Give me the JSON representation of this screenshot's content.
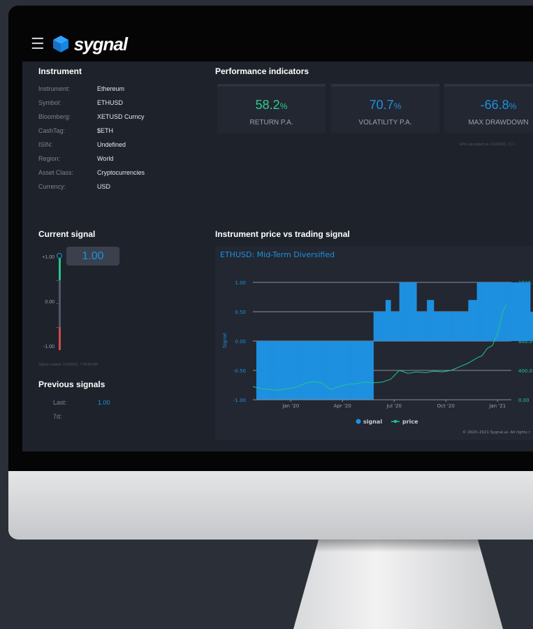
{
  "app": {
    "name": "sygnal"
  },
  "instrument": {
    "title": "Instrument",
    "fields": [
      {
        "label": "Instrument:",
        "value": "Ethereum"
      },
      {
        "label": "Symbol:",
        "value": "ETHUSD"
      },
      {
        "label": "Bloomberg:",
        "value": "XETUSD Curncy"
      },
      {
        "label": "CashTag:",
        "value": "$ETH"
      },
      {
        "label": "ISIN:",
        "value": "Undefined"
      },
      {
        "label": "Region:",
        "value": "World"
      },
      {
        "label": "Asset Class:",
        "value": "Cryptocurrencies"
      },
      {
        "label": "Currency:",
        "value": "USD"
      }
    ]
  },
  "performance": {
    "title": "Performance indicators",
    "kpis": [
      {
        "value": "58.2",
        "unit": "%",
        "label": "RETURN P.A.",
        "color": "#2ecc8f"
      },
      {
        "value": "70.7",
        "unit": "%",
        "label": "VOLATILITY P.A.",
        "color": "#1e90e0"
      },
      {
        "value": "-66.8",
        "unit": "%",
        "label": "MAX DRAWDOWN",
        "color": "#1e90e0"
      }
    ],
    "note": "KPIs calculated on: 1/12/2021, 11:1"
  },
  "current_signal": {
    "title": "Current signal",
    "value": "1.00",
    "gauge_labels": [
      "+1.00",
      "0.00",
      "-1.00"
    ],
    "created": "Signal created: 1/19/2021, 7:00:00 AM"
  },
  "previous_signals": {
    "title": "Previous signals",
    "rows": [
      {
        "label": "Last:",
        "value": "1.00"
      },
      {
        "label": "7d:",
        "value": ""
      }
    ]
  },
  "chart_section": {
    "title": "Instrument price vs trading signal"
  },
  "chart_data": {
    "type": "bar",
    "title": "ETHUSD: Mid-Term Diversified",
    "ylabel": "Signal",
    "ylim": [
      -1,
      1
    ],
    "y2lim": [
      0,
      1600
    ],
    "y_ticks": [
      "1.00",
      "0.50",
      "0.00",
      "-0.50",
      "-1.00"
    ],
    "y2_ticks": [
      "1600.",
      "1200.",
      "800.0",
      "400.0",
      "0.00"
    ],
    "x_ticks": [
      "Jan '20",
      "Apr '20",
      "Jul '20",
      "Oct '20",
      "Jan '21"
    ],
    "x_tick_months": [
      2.2,
      5.2,
      8.2,
      11.2,
      14.2
    ],
    "legend": [
      "signal",
      "price"
    ],
    "legend_position": "bottom",
    "copyright": "© 2020–2021 Sygnal.ai. All rights r",
    "colors": {
      "signal": "#1e90e0",
      "price": "#1fc98a"
    },
    "signal": {
      "start_month": 0,
      "step_months": 0.1,
      "values": [
        0,
        0,
        -1,
        -1,
        -1,
        -1,
        -1,
        -1,
        -1,
        -1,
        -1,
        -1,
        -1,
        -1,
        -1,
        -1,
        -1,
        -1,
        -1,
        -1,
        -1,
        -1,
        -1,
        -1,
        -1,
        -1,
        -1,
        -1,
        -1,
        -1,
        -1,
        -1,
        -1,
        -1,
        -1,
        -1,
        -1,
        -1,
        -1,
        -1,
        -1,
        -1,
        -1,
        -1,
        -1,
        -1,
        -1,
        -1,
        -1,
        -1,
        -1,
        -1,
        -1,
        -1,
        -1,
        -1,
        -1,
        -1,
        -1,
        -1,
        -1,
        -1,
        -1,
        -1,
        -1,
        -1,
        -1,
        -1,
        -1,
        -1,
        0.5,
        0.5,
        0.5,
        0.5,
        0.5,
        0.5,
        0.5,
        0.7,
        0.7,
        0.7,
        0.5,
        0.5,
        0.5,
        0.5,
        0.5,
        1,
        1,
        1,
        1,
        1,
        1,
        1,
        1,
        1,
        1,
        0.5,
        0.5,
        0.5,
        0.5,
        0.5,
        0.5,
        0.7,
        0.7,
        0.7,
        0.7,
        0.5,
        0.5,
        0.5,
        0.5,
        0.5,
        0.5,
        0.5,
        0.5,
        0.5,
        0.5,
        0.5,
        0.5,
        0.5,
        0.5,
        0.5,
        0.5,
        0.5,
        0.5,
        0.5,
        0.5,
        0.7,
        0.7,
        0.7,
        0.7,
        0.7,
        1,
        1,
        1,
        1,
        1,
        1,
        1,
        1,
        1,
        1,
        1,
        1,
        1,
        1,
        1,
        1,
        1,
        1,
        1,
        1,
        1,
        1,
        1,
        1,
        1,
        1,
        1,
        1,
        1,
        1,
        1,
        0.5,
        0.5,
        0.5,
        0.5,
        0.5,
        0.5,
        0.5,
        0.5,
        0.5,
        0.5,
        0.5,
        0.5,
        0.5,
        0.5,
        0.5,
        0.5,
        0.5,
        0.5,
        0.5,
        0.5,
        0.5,
        0.5,
        0.5,
        0.5,
        0.5,
        0.5,
        0.5,
        0.5,
        0.5,
        0.5,
        0.5,
        0.5,
        0.5,
        0.5,
        0.5,
        0.5,
        0.5,
        0.5,
        0.5,
        0.5,
        0.5,
        0.5,
        0.5,
        0.5,
        0.5,
        1,
        1,
        1,
        1,
        1,
        1,
        1,
        1,
        1,
        1,
        1,
        1,
        1,
        1,
        1,
        1,
        1,
        1,
        1,
        1,
        1,
        1,
        1,
        1,
        1,
        1,
        1,
        1,
        1,
        1,
        1,
        1,
        1,
        1,
        1,
        1,
        1,
        1,
        1,
        1
      ]
    },
    "price": {
      "months": [
        0,
        0.5,
        1,
        1.5,
        2,
        2.5,
        3,
        3.5,
        4,
        4.5,
        5,
        5.5,
        6,
        6.5,
        7,
        7.5,
        8,
        8.5,
        9,
        9.5,
        10,
        10.5,
        11,
        11.5,
        12,
        12.5,
        13,
        13.3,
        13.6,
        13.9,
        14.2,
        14.5,
        14.7
      ],
      "values": [
        180,
        150,
        140,
        130,
        150,
        170,
        220,
        250,
        230,
        140,
        180,
        210,
        220,
        240,
        230,
        240,
        280,
        400,
        360,
        380,
        370,
        390,
        380,
        400,
        450,
        500,
        570,
        600,
        700,
        740,
        900,
        1200,
        1300
      ]
    }
  }
}
